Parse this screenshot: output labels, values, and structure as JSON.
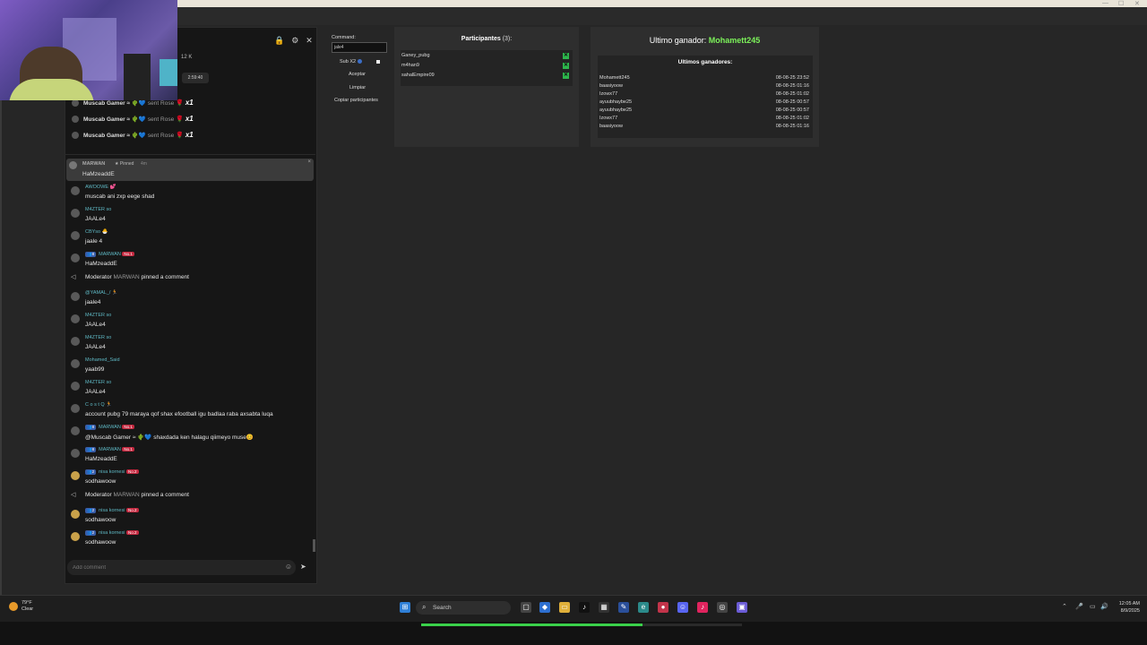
{
  "chat": {
    "likes": "12 K",
    "timer": "2:59:40",
    "gifts": [
      {
        "user": "Muscab Gamer ≈ 🌵💙",
        "sent": "sent Rose",
        "mult": "x1"
      },
      {
        "user": "Muscab Gamer ≈ 🌵💙",
        "sent": "sent Rose",
        "mult": "x1"
      },
      {
        "user": "Muscab Gamer ≈ 🌵💙",
        "sent": "sent Rose",
        "mult": "x1"
      }
    ],
    "pinned": {
      "user": "MARWAN",
      "label": "★ Pinned",
      "ago": "4m",
      "text": "HaMzeaddE"
    },
    "messages": [
      {
        "user": "AWOOWE 💕",
        "text": "muscab ani zxp eege shad"
      },
      {
        "user": "M4ZTER so",
        "text": "JAALe4"
      },
      {
        "user": "CBYso 🐣",
        "text": "jaale 4"
      },
      {
        "user": "MARWAN",
        "badge": "👥8",
        "badge2": "No.1",
        "text": "HaMzeaddE"
      }
    ],
    "sys1": {
      "prefix": "Moderator",
      "mod": "MARWAN",
      "text": "pinned a comment"
    },
    "messages2": [
      {
        "user": "@YAMAL_/ 🏃",
        "text": "jaale4"
      },
      {
        "user": "M4ZTER so",
        "text": "JAALe4"
      },
      {
        "user": "M4ZTER so",
        "text": "JAALe4"
      },
      {
        "user": "Mohamed_Said",
        "text": "yaab99"
      },
      {
        "user": "M4ZTER so",
        "text": "JAALe4"
      },
      {
        "user": "C o s t Q 🏃",
        "text": "account pubg 79 maraya qof shax efootball igu badlaa raba axsabta luqa"
      },
      {
        "user": "MARWAN",
        "badge": "👥8",
        "badge2": "No.1",
        "text": "@Muscab Gamer ≈ 🌵💙 shaxdada ken halagu qiimeyo muse😊"
      },
      {
        "user": "MARWAN",
        "badge": "👥8",
        "badge2": "No.1",
        "text": "HaMzeaddE"
      },
      {
        "user": "nisa kornesi",
        "badge": "👥2",
        "badge2": "No.2",
        "text": "sodhawoow"
      }
    ],
    "sys2": {
      "prefix": "Moderator",
      "mod": "MARWAN",
      "text": "pinned a comment"
    },
    "messages3": [
      {
        "user": "nisa kornesi",
        "badge": "👥2",
        "badge2": "No.2",
        "text": "sodhawoow"
      },
      {
        "user": "nisa kornesi",
        "badge": "👥2",
        "badge2": "No.2",
        "text": "sodhawoow"
      }
    ],
    "comment_placeholder": "Add comment"
  },
  "command": {
    "label": "Command:",
    "value": "jale4",
    "sub_label": "Sub X2",
    "accept": "Aceptar",
    "clear": "Limpiar",
    "copy": "Copiar participantes"
  },
  "participants": {
    "title": "Participantes",
    "count": "(3):",
    "items": [
      "Ganey_pubg",
      "m4han9",
      "sahalEmpire09"
    ]
  },
  "winners": {
    "last_label": "Ultimo ganador:",
    "last_name": "Mohamett245",
    "list_title": "Ultimos ganadores:",
    "rows": [
      {
        "name": "Mohamett245",
        "date": "08-08-25 23:52"
      },
      {
        "name": "baasiyoow",
        "date": "08-08-25 01:16"
      },
      {
        "name": "Izowx77",
        "date": "08-08-25 01:02"
      },
      {
        "name": "ayuubhaybe25",
        "date": "08-08-25 00:57"
      },
      {
        "name": "ayuubhaybe25",
        "date": "08-08-25 00:57"
      },
      {
        "name": "Izowx77",
        "date": "08-08-25 01:02"
      },
      {
        "name": "baasiyoow",
        "date": "08-08-25 01:16"
      }
    ]
  },
  "taskbar": {
    "temp": "79°F",
    "cond": "Clear",
    "search": "Search",
    "time": "12:05 AM",
    "date": "8/9/2025"
  },
  "progress": 0.69,
  "colors": {
    "accent_green": "#7cf25a",
    "remove_green": "#2db64c",
    "name_teal": "#5fb8c4"
  }
}
